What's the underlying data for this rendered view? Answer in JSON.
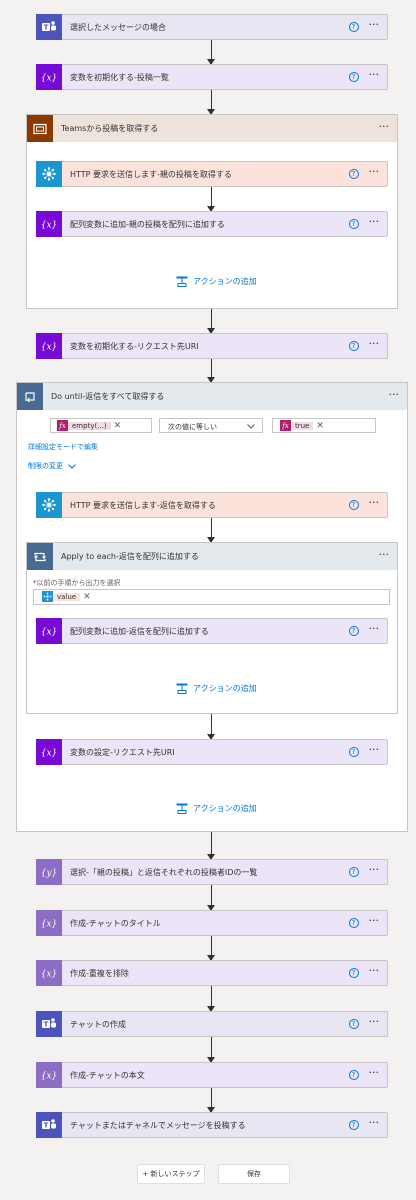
{
  "steps": {
    "selected_message": "選択したメッセージの場合",
    "init_posts": "変数を初期化する-投稿一覧",
    "scope_title": "Teamsから投稿を取得する",
    "http_parent": "HTTP 要求を送信します-親の投稿を取得する",
    "append_parent": "配列変数に追加-親の投稿を配列に追加する",
    "init_request_uri": "変数を初期化する-リクエスト先URI",
    "do_until_title": "Do until-返信をすべて取得する",
    "http_replies": "HTTP 要求を送信します-返信を取得する",
    "apply_each_title": "Apply to each-返信を配列に追加する",
    "append_replies": "配列変数に追加-返信を配列に追加する",
    "set_request_uri": "変数の設定-リクエスト先URI",
    "select_ids": "選択-「親の投稿」と返信それぞれの投稿者IDの一覧",
    "compose_chat_title": "作成-チャットのタイトル",
    "compose_dedupe": "作成-重複を排除",
    "create_chat": "チャットの作成",
    "compose_chat_body": "作成-チャットの本文",
    "post_message": "チャットまたはチャネルでメッセージを投稿する"
  },
  "common": {
    "help_glyph": "?",
    "more_glyph": "···",
    "add_action": "アクションの追加",
    "remove_glyph": "✕",
    "fx_glyph": "fx"
  },
  "do_until": {
    "left_token": "empty(...)",
    "operator": "次の値に等しい",
    "right_token": "true",
    "advanced_mode": "詳細設定モードで編集",
    "limits": "制限の変更",
    "limits_chevron": "⌄"
  },
  "apply_each": {
    "required_mark": "*",
    "field_label": "以前の手順から出力を選択",
    "output_token": "value"
  },
  "footer": {
    "new_step": "+ 新しいステップ",
    "save": "保存"
  },
  "icons": {
    "teams": "teams-icon",
    "variable": "variable-icon",
    "http": "http-icon",
    "scope": "scope-icon",
    "loop": "do-until-icon",
    "foreach": "apply-to-each-icon",
    "data_operation": "data-operation-icon",
    "add_action": "add-action-icon"
  },
  "colors": {
    "teams": "#4b53bc",
    "variable": "#770bd6",
    "http": "#1c96d1",
    "scope": "#8c3900",
    "control": "#486991",
    "data_operation": "#8c6cc4",
    "link": "#0078d4"
  }
}
